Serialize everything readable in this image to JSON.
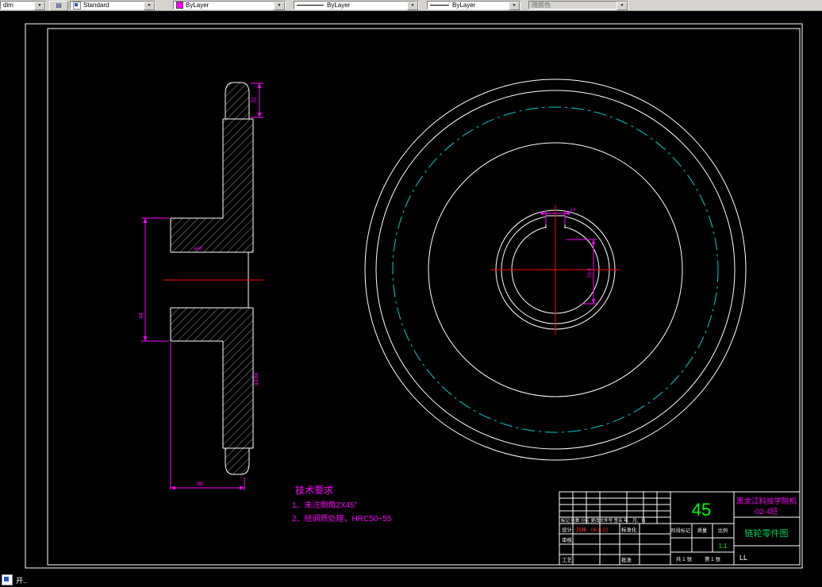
{
  "toolbar": {
    "layer": "dim",
    "text_style": "Standard",
    "color": "ByLayer",
    "linetype": "ByLayer",
    "lineweight": "ByLayer",
    "plot_style": "随颜色"
  },
  "icons": {
    "dropdown_arrow": "▼",
    "layer_button": "▤"
  },
  "colors": {
    "dimension": "#ff00ff",
    "centerline": "#ff0000",
    "pitch_circle": "#00cccc",
    "outline": "#ffffff",
    "material_text": "#00ff00"
  },
  "tech_requirements": {
    "title": "技术要求",
    "item1": "1、未注倒角2X45°",
    "item2": "2、经调质处理，HRC50~55"
  },
  "dimensions": {
    "tooth_width": "32",
    "hub_length": "44",
    "bore_dia": "φ40",
    "disc_dia": "φ194",
    "hub_width": "88",
    "keyway_width": "14",
    "keyway_depth": "53.8"
  },
  "title_block": {
    "school_line1": "黑龙江科技学院机",
    "school_line2": "02-4班",
    "material": "45",
    "part_name": "链轮零件图",
    "rev_header": "标记 处数 分区 更改文件号 签名 年、月、日",
    "design_label": "设计",
    "designer": "刘峰",
    "date": "06.6.22",
    "standardization_label": "标准化",
    "audit_label": "审核",
    "process_label": "工艺",
    "approve_label": "批准",
    "stage_label": "阶段标记",
    "weight_label": "质量",
    "scale_label": "比例",
    "scale_value": "1:1",
    "sheets_total": "共 1 张",
    "sheet_no": "第 1 张",
    "signature": "LL"
  },
  "taskbar": {
    "item_label": "开.."
  }
}
